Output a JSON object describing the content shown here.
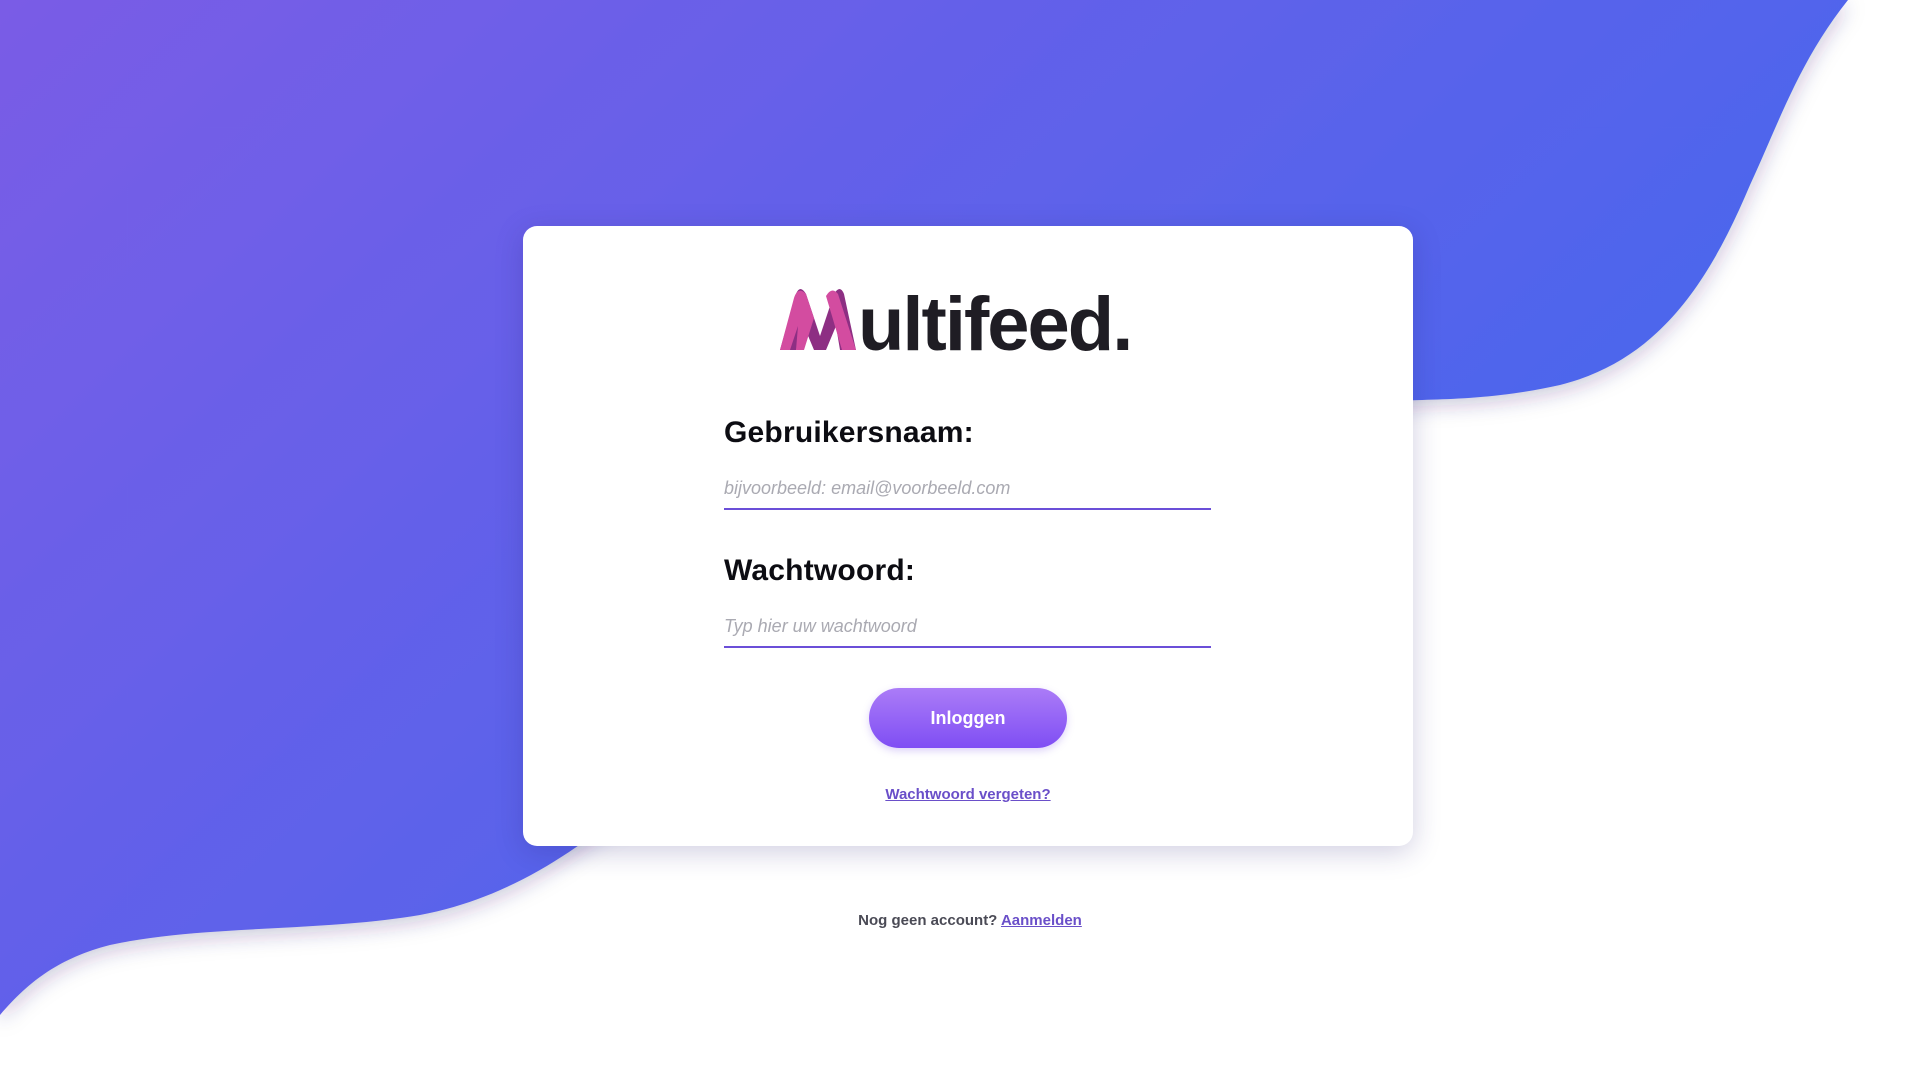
{
  "logo": {
    "text": "ultifeed.",
    "colors": {
      "m_light": "#d34ca0",
      "m_dark": "#8d2f83",
      "word": "#1f1d24"
    }
  },
  "form": {
    "username_label": "Gebruikersnaam:",
    "username_placeholder": "bijvoorbeeld: email@voorbeeld.com",
    "username_value": "",
    "password_label": "Wachtwoord:",
    "password_placeholder": "Typ hier uw wachtwoord",
    "password_value": "",
    "login_button": "Inloggen",
    "forgot_link": "Wachtwoord vergeten?"
  },
  "footer": {
    "question": "Nog geen account?",
    "signup_link": "Aanmelden"
  },
  "colors": {
    "gradient_start": "#7a5ce6",
    "gradient_end": "#4268ee",
    "accent": "#6a4fc9",
    "button_top": "#ab7cf7",
    "button_bottom": "#7f4ef4"
  }
}
